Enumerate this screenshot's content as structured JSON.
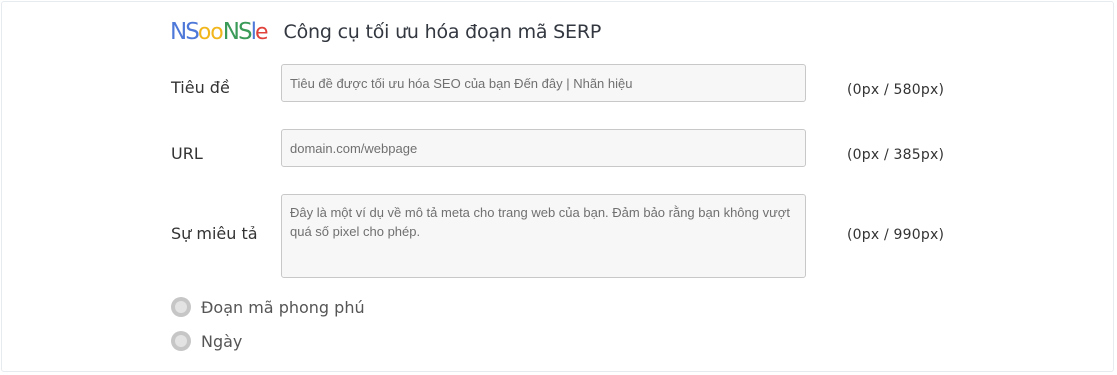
{
  "header": {
    "logo_letters": [
      {
        "char": "N",
        "color": "#4f79d9",
        "small": false
      },
      {
        "char": "S",
        "color": "#4f79d9",
        "small": false
      },
      {
        "char": "o",
        "color": "#f1b61b",
        "small": true
      },
      {
        "char": "o",
        "color": "#f1b61b",
        "small": true
      },
      {
        "char": "N",
        "color": "#3a9a58",
        "small": false
      },
      {
        "char": "S",
        "color": "#3a9a58",
        "small": false
      },
      {
        "char": "l",
        "color": "#4f79d9",
        "small": false
      },
      {
        "char": "e",
        "color": "#e0413b",
        "small": true
      }
    ],
    "title": "Công cụ tối ưu hóa đoạn mã SERP"
  },
  "form": {
    "title_label": "Tiêu đề",
    "title_placeholder": "Tiêu đề được tối ưu hóa SEO của bạn Đến đây |  Nhãn hiệu",
    "title_counter": "(0px / 580px)",
    "url_label": "URL",
    "url_placeholder": "domain.com/webpage",
    "url_counter": "(0px / 385px)",
    "desc_label": "Sự miêu tả",
    "desc_placeholder": "Đây là một ví dụ về mô tả meta cho trang web của bạn.  Đảm bảo rằng bạn không vượt quá số pixel cho phép.",
    "desc_counter": "(0px / 990px)"
  },
  "options": {
    "rich_snippet_label": "Đoạn mã phong phú",
    "date_label": "Ngày"
  }
}
